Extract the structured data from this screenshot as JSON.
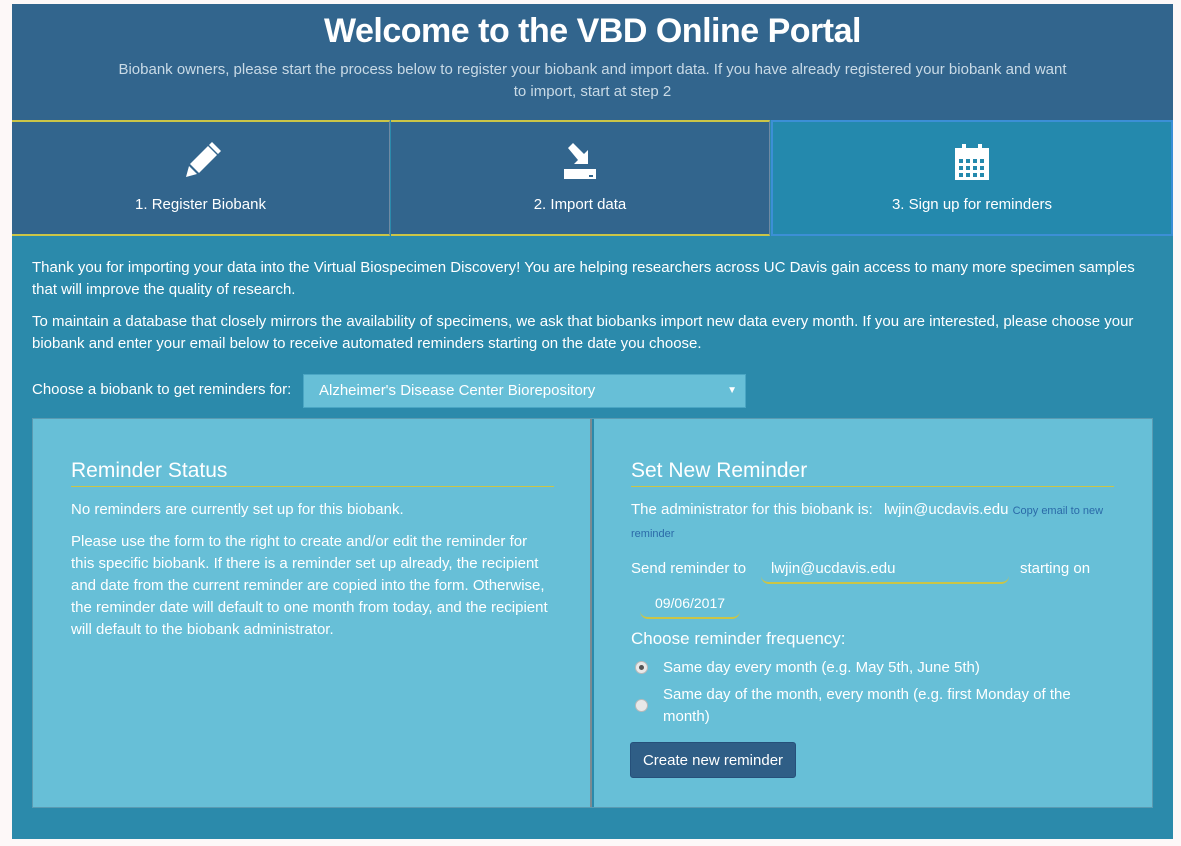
{
  "header": {
    "title": "Welcome to the VBD Online Portal",
    "subtitle": "Biobank owners, please start the process below to register your biobank and import data. If you have already registered your biobank and want to import, start at step 2"
  },
  "steps": [
    {
      "label": "1. Register Biobank",
      "icon": "pencil-icon"
    },
    {
      "label": "2. Import data",
      "icon": "import-icon"
    },
    {
      "label": "3. Sign up for reminders",
      "icon": "calendar-icon",
      "active": true
    }
  ],
  "intro": {
    "thanks": "Thank you for importing your data into the Virtual Biospecimen Discovery! You are helping researchers across UC Davis gain access to many more specimen samples that will improve the quality of research.",
    "maintain": "To maintain a database that closely mirrors the availability of specimens, we ask that biobanks import new data every month. If you are interested, please choose your biobank and enter your email below to receive automated reminders starting on the date you choose."
  },
  "biobank_select": {
    "label": "Choose a biobank to get reminders for:",
    "selected": "Alzheimer's Disease Center Biorepository"
  },
  "status_panel": {
    "heading": "Reminder Status",
    "no_reminders": "No reminders are currently set up for this biobank.",
    "instructions": "Please use the form to the right to create and/or edit the reminder for this specific biobank. If there is a reminder set up already, the recipient and date from the current reminder are copied into the form. Otherwise, the reminder date will default to one month from today, and the recipient will default to the biobank administrator."
  },
  "new_panel": {
    "heading": "Set New Reminder",
    "admin_label": "The administrator for this biobank is:",
    "admin_email": "lwjin@ucdavis.edu",
    "copy_link": "Copy email to new reminder",
    "send_label": "Send reminder to",
    "email_value": "lwjin@ucdavis.edu",
    "starting_label": "starting on",
    "date_value": "09/06/2017",
    "frequency_label": "Choose reminder frequency:",
    "options": [
      {
        "label": "Same day every month (e.g. May 5th, June 5th)",
        "checked": true
      },
      {
        "label": "Same day of the month, every month (e.g. first Monday of the month)",
        "checked": false
      }
    ],
    "create_button": "Create new reminder"
  },
  "colors": {
    "header_bg": "#32658d",
    "content_bg": "#2b8aab",
    "panel_bg": "#67bfd7",
    "accent_yellow": "#cbc547",
    "button_bg": "#2f5e86"
  }
}
